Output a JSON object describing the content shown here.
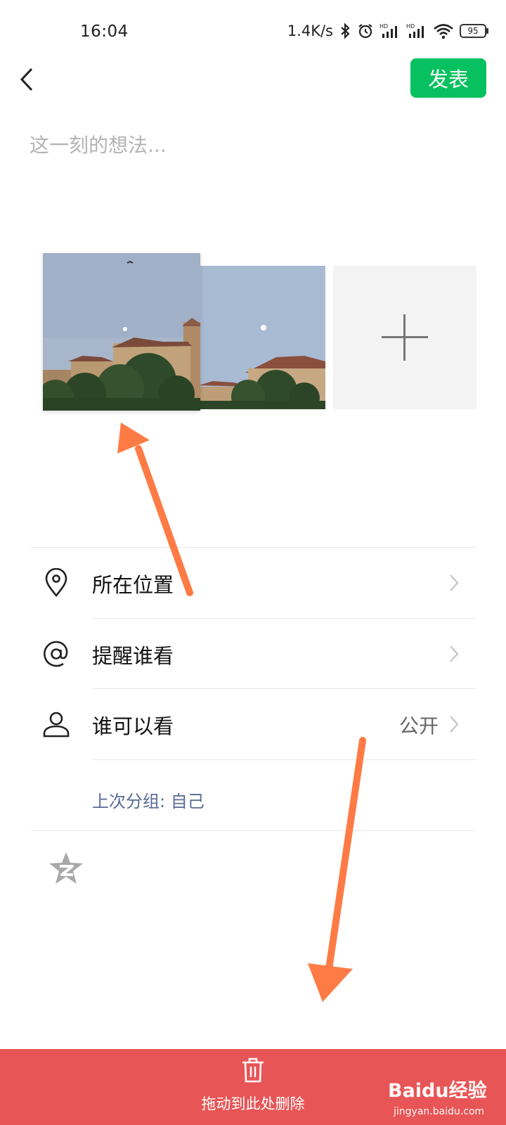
{
  "status_bar": {
    "time": "16:04",
    "network_speed": "1.4K/s",
    "battery": "95",
    "icons": [
      "bluetooth-icon",
      "alarm-icon",
      "signal-hd-icon",
      "signal-hd-icon",
      "wifi-icon",
      "battery-icon"
    ]
  },
  "header": {
    "publish_label": "发表"
  },
  "composer": {
    "placeholder": "这一刻的想法..."
  },
  "options": {
    "location_label": "所在位置",
    "mention_label": "提醒谁看",
    "visibility_label": "谁可以看",
    "visibility_value": "公开",
    "last_group": "上次分组: 自己"
  },
  "delete_bar": {
    "label": "拖动到此处删除"
  },
  "watermark": {
    "brand": "Baidu经验",
    "url": "jingyan.baidu.com"
  },
  "colors": {
    "publish_green": "#07c160",
    "delete_red": "#e85556",
    "link_blue": "#576b95",
    "annotation_arrow": "#ff7b45"
  }
}
